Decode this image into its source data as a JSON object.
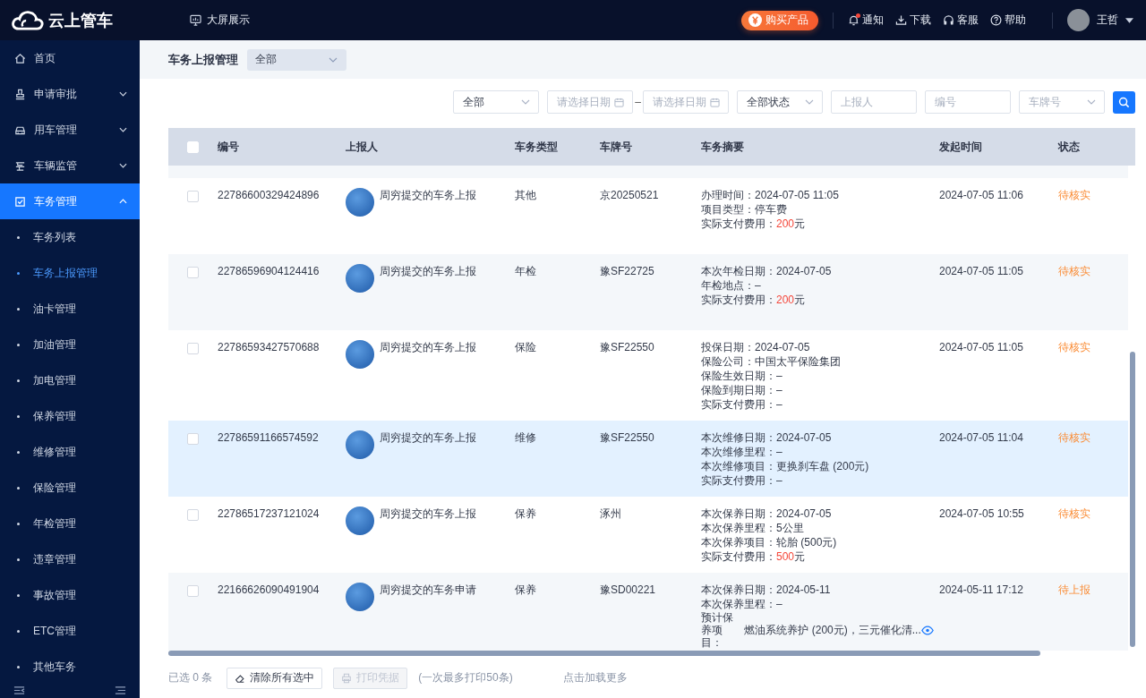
{
  "header": {
    "logo": "云上管车",
    "screen_link": "大屏展示",
    "buy_button": "购买产品",
    "actions": [
      {
        "kind": "bell",
        "label": "通知",
        "unread": true
      },
      {
        "kind": "download",
        "label": "下载",
        "unread": false
      },
      {
        "kind": "headset",
        "label": "客服",
        "unread": false
      },
      {
        "kind": "help",
        "label": "帮助",
        "unread": false
      }
    ],
    "user": "王哲"
  },
  "sidebar": {
    "items": [
      {
        "kind": "home",
        "label": "首页",
        "selected": false
      },
      {
        "kind": "stamp",
        "label": "申请审批",
        "expanded": false,
        "selected": false
      },
      {
        "kind": "car",
        "label": "用车管理",
        "expanded": false,
        "selected": false
      },
      {
        "kind": "monitor",
        "label": "车辆监管",
        "expanded": false,
        "selected": false
      },
      {
        "kind": "task",
        "label": "车务管理",
        "expanded": true,
        "selected": true,
        "children": [
          {
            "label": "车务列表",
            "selected": false
          },
          {
            "label": "车务上报管理",
            "selected": true
          },
          {
            "label": "油卡管理",
            "selected": false
          },
          {
            "label": "加油管理",
            "selected": false
          },
          {
            "label": "加电管理",
            "selected": false
          },
          {
            "label": "保养管理",
            "selected": false
          },
          {
            "label": "维修管理",
            "selected": false
          },
          {
            "label": "保险管理",
            "selected": false
          },
          {
            "label": "年检管理",
            "selected": false
          },
          {
            "label": "违章管理",
            "selected": false
          },
          {
            "label": "事故管理",
            "selected": false
          },
          {
            "label": "ETC管理",
            "selected": false
          },
          {
            "label": "其他车务",
            "selected": false
          }
        ]
      }
    ]
  },
  "page": {
    "title": "车务上报管理",
    "scope_select": "全部"
  },
  "filters": [
    {
      "kind": "select",
      "value": "全部"
    },
    {
      "kind": "date",
      "placeholder": "请选择日期"
    },
    {
      "kind": "dash",
      "value": "–"
    },
    {
      "kind": "date",
      "placeholder": "请选择日期"
    },
    {
      "kind": "select",
      "value": "全部状态"
    },
    {
      "kind": "input",
      "placeholder": "上报人"
    },
    {
      "kind": "input",
      "placeholder": "编号"
    },
    {
      "kind": "select",
      "placeholder": "车牌号"
    }
  ],
  "table": {
    "columns": [
      "编号",
      "上报人",
      "车务类型",
      "车牌号",
      "车务摘要",
      "发起时间",
      "状态"
    ],
    "all_checked": false,
    "rows": [
      {
        "id": "22786600329424896",
        "reporter": "周穷提交的车务上报",
        "type": "其他",
        "plate": "京20250521",
        "time": "2024-07-05 11:06",
        "status": "待核实",
        "checked": false,
        "highlighted": false,
        "summary": [
          {
            "kind": "line",
            "text": "办理时间：2024-07-05 11:05"
          },
          {
            "kind": "line",
            "text": "项目类型：停车费"
          },
          {
            "kind": "line",
            "label": "实际支付费用：",
            "amount": "200",
            "unit": "元"
          }
        ]
      },
      {
        "id": "22786596904124416",
        "reporter": "周穷提交的车务上报",
        "type": "年检",
        "plate": "豫SF22725",
        "time": "2024-07-05 11:05",
        "status": "待核实",
        "checked": false,
        "highlighted": false,
        "summary": [
          {
            "kind": "line",
            "text": "本次年检日期：2024-07-05"
          },
          {
            "kind": "line",
            "text": "年检地点：–"
          },
          {
            "kind": "line",
            "label": "实际支付费用：",
            "amount": "200",
            "unit": "元"
          }
        ]
      },
      {
        "id": "22786593427570688",
        "reporter": "周穷提交的车务上报",
        "type": "保险",
        "plate": "豫SF22550",
        "time": "2024-07-05 11:05",
        "status": "待核实",
        "checked": false,
        "highlighted": false,
        "summary": [
          {
            "kind": "line",
            "text": "投保日期：2024-07-05"
          },
          {
            "kind": "line",
            "text": "保险公司：中国太平保险集团"
          },
          {
            "kind": "line",
            "text": "保险生效日期：–"
          },
          {
            "kind": "line",
            "text": "保险到期日期：–"
          },
          {
            "kind": "line",
            "text": "实际支付费用：–"
          }
        ]
      },
      {
        "id": "22786591166574592",
        "reporter": "周穷提交的车务上报",
        "type": "维修",
        "plate": "豫SF22550",
        "time": "2024-07-05 11:04",
        "status": "待核实",
        "checked": false,
        "highlighted": true,
        "summary": [
          {
            "kind": "line",
            "text": "本次维修日期：2024-07-05"
          },
          {
            "kind": "line",
            "text": "本次维修里程：–"
          },
          {
            "kind": "line",
            "text": "本次维修项目：更换刹车盘 (200元)"
          },
          {
            "kind": "line",
            "text": "实际支付费用：–"
          }
        ]
      },
      {
        "id": "22786517237121024",
        "reporter": "周穷提交的车务上报",
        "type": "保养",
        "plate": "涿州",
        "time": "2024-07-05 10:55",
        "status": "待核实",
        "checked": false,
        "highlighted": false,
        "summary": [
          {
            "kind": "line",
            "text": "本次保养日期：2024-07-05"
          },
          {
            "kind": "line",
            "text": "本次保养里程：5公里"
          },
          {
            "kind": "line",
            "text": "本次保养项目：轮胎 (500元)"
          },
          {
            "kind": "line",
            "label": "实际支付费用：",
            "amount": "500",
            "unit": "元"
          }
        ]
      },
      {
        "id": "22166626090491904",
        "reporter": "周穷提交的车务申请",
        "type": "保养",
        "plate": "豫SD00221",
        "time": "2024-05-11 17:12",
        "status": "待上报",
        "checked": false,
        "highlighted": false,
        "summary": [
          {
            "kind": "line",
            "text": "本次保养日期：2024-05-11"
          },
          {
            "kind": "line",
            "text": "本次保养里程：–"
          },
          {
            "kind": "wrapped",
            "label": "预计保养项目：",
            "value": "燃油系统养护 (200元)，三元催化清..."
          }
        ]
      }
    ]
  },
  "footer": {
    "selected_count": "已选 0 条",
    "clear_button": "清除所有选中",
    "print_button": "打印凭据",
    "print_disabled": true,
    "print_hint": "(一次最多打印50条)",
    "load_more": "点击加载更多"
  }
}
